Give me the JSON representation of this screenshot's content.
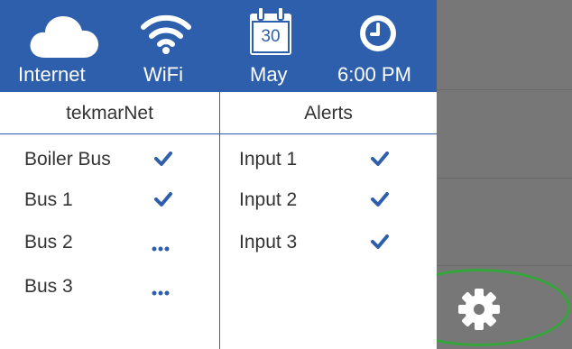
{
  "topbar": {
    "internet_label": "Internet",
    "wifi_label": "WiFi",
    "calendar_day": "30",
    "calendar_month": "May",
    "time": "6:00 PM"
  },
  "tekmarnet": {
    "title": "tekmarNet",
    "items": [
      {
        "label": "Boiler Bus",
        "status": "check"
      },
      {
        "label": "Bus 1",
        "status": "check"
      },
      {
        "label": "Bus 2",
        "status": "dots"
      },
      {
        "label": "Bus 3",
        "status": "dots"
      }
    ]
  },
  "alerts": {
    "title": "Alerts",
    "items": [
      {
        "label": "Input 1",
        "status": "check"
      },
      {
        "label": "Input 2",
        "status": "check"
      },
      {
        "label": "Input 3",
        "status": "check"
      }
    ]
  },
  "sidebar": {
    "settings_icon": "gear-icon"
  },
  "colors": {
    "header_blue": "#2d5fac",
    "sidebar_gray": "#777777",
    "highlight_green": "#34a63b"
  }
}
